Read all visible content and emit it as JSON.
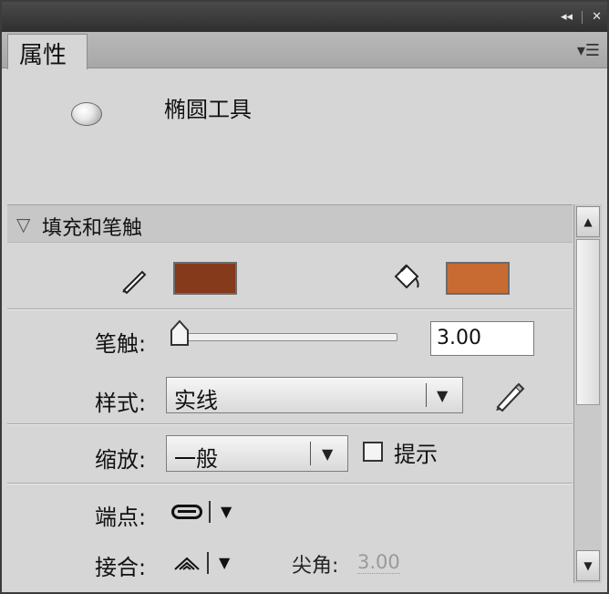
{
  "panel": {
    "tab_label": "属性",
    "tool_name": "椭圆工具",
    "section_title": "填充和笔触",
    "colors": {
      "stroke": "#843A1B",
      "fill": "#C86B33"
    }
  },
  "stroke": {
    "label": "笔触:",
    "value": "3.00"
  },
  "style": {
    "label": "样式:",
    "selected": "实线"
  },
  "scale": {
    "label": "缩放:",
    "selected": "一般",
    "hint_label": "提示"
  },
  "cap": {
    "label": "端点:"
  },
  "join": {
    "label": "接合:",
    "miter_label": "尖角:",
    "miter_value": "3.00"
  }
}
